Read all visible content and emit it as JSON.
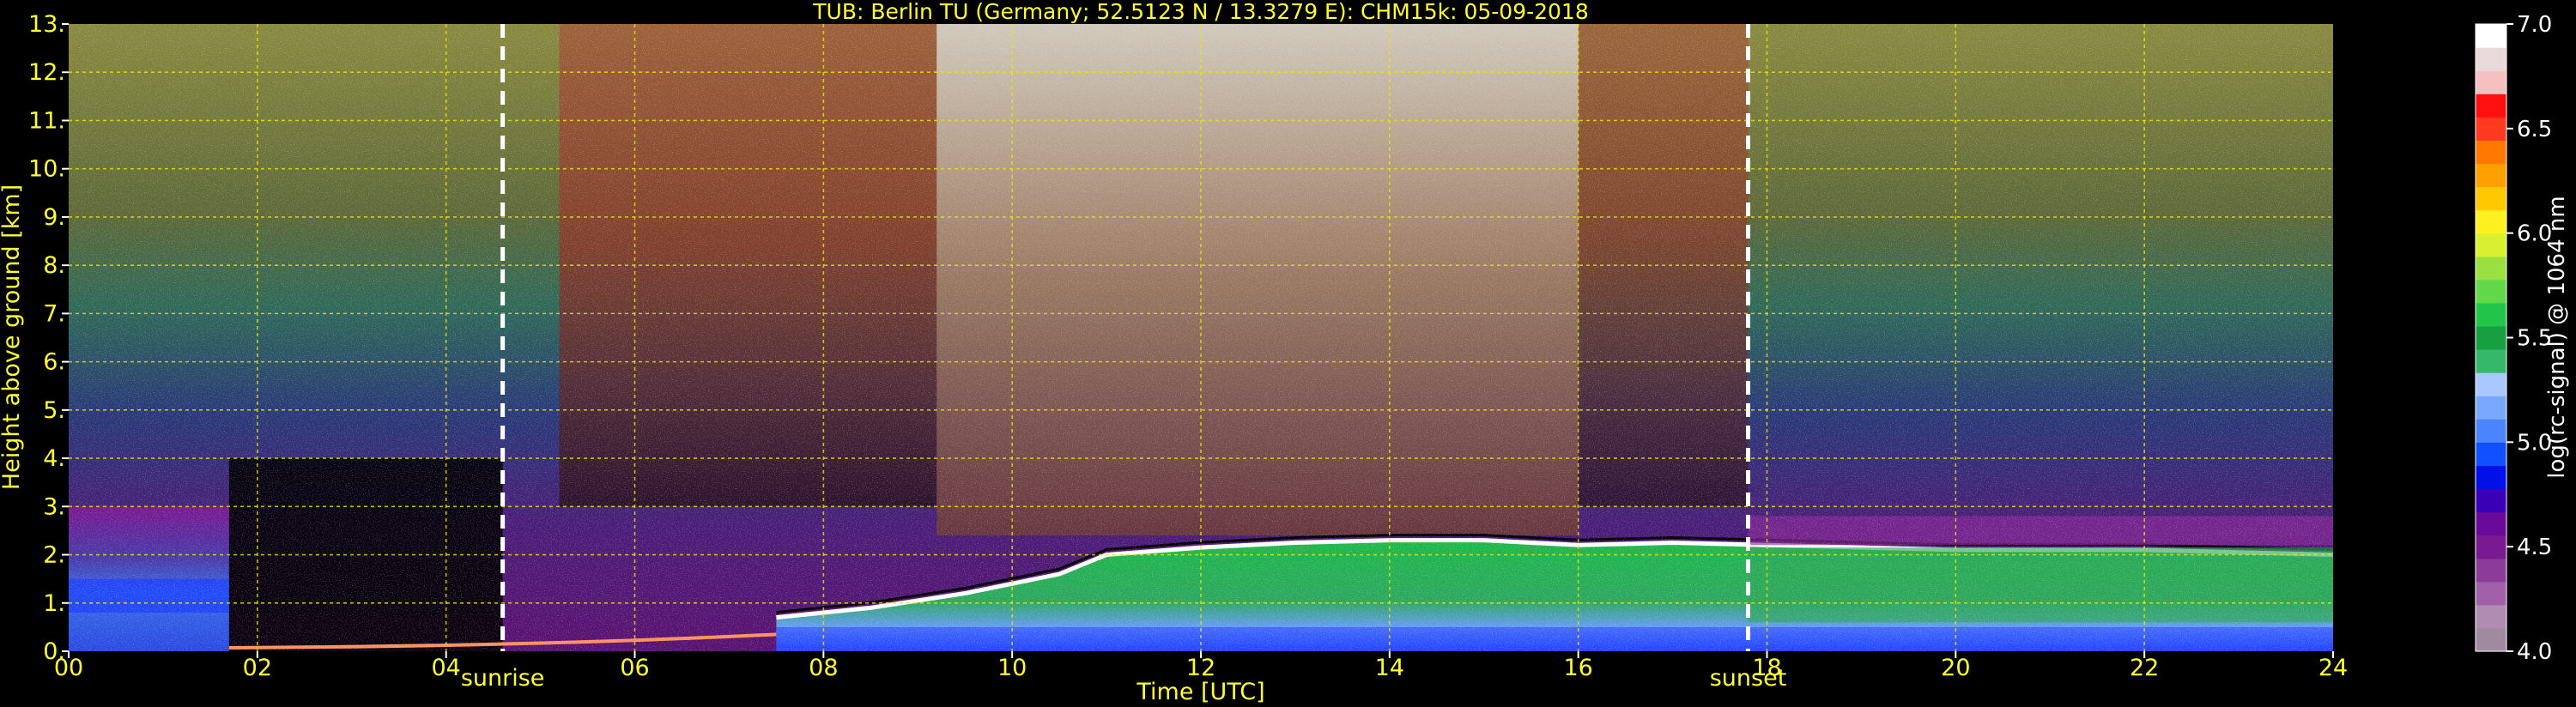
{
  "chart_data": {
    "type": "heatmap",
    "title": "TUB: Berlin TU (Germany; 52.5123 N / 13.3279 E):    CHM15k: 05-09-2018",
    "xlabel": "Time [UTC]",
    "ylabel": "Height above ground [km]",
    "xlim": [
      0,
      24
    ],
    "ylim": [
      0,
      13
    ],
    "x_ticks": [
      0,
      2,
      4,
      6,
      8,
      10,
      12,
      14,
      16,
      18,
      20,
      22,
      24
    ],
    "x_tick_labels": [
      "00",
      "02",
      "04",
      "06",
      "08",
      "10",
      "12",
      "14",
      "16",
      "18",
      "20",
      "22",
      "24"
    ],
    "y_ticks": [
      0,
      1,
      2,
      3,
      4,
      5,
      6,
      7,
      8,
      9,
      10,
      11,
      12,
      13
    ],
    "y_tick_labels": [
      "0.",
      "1.",
      "2.",
      "3.",
      "4.",
      "5.",
      "6.",
      "7.",
      "8.",
      "9.",
      "10.",
      "11.",
      "12.",
      "13."
    ],
    "grid": true,
    "colorbar": {
      "label": "log(rc-signal) @ 1064 nm",
      "range": [
        4.0,
        7.0
      ],
      "ticks": [
        4.0,
        4.5,
        5.0,
        5.5,
        6.0,
        6.5,
        7.0
      ],
      "tick_labels": [
        "4.0",
        "4.5",
        "5.0",
        "5.5",
        "6.0",
        "6.5",
        "7.0"
      ],
      "colors": [
        "#a08aa0",
        "#b08cb0",
        "#a060a8",
        "#8a3c98",
        "#7a1a90",
        "#6a0a9a",
        "#3a00b8",
        "#0010e8",
        "#1050ff",
        "#4a84ff",
        "#7aa8ff",
        "#a8c8ff",
        "#36b86a",
        "#16a040",
        "#22c44a",
        "#60d84a",
        "#9ae040",
        "#d8f030",
        "#fff020",
        "#ffc800",
        "#ffa000",
        "#ff7800",
        "#ff3a20",
        "#ff1010",
        "#f4c0c0",
        "#e8dada",
        "#ffffff"
      ]
    },
    "annotations": [
      {
        "label": "sunrise",
        "x": 4.6
      },
      {
        "label": "sunset",
        "x": 17.8
      }
    ],
    "layers": [
      {
        "name": "residual-layer",
        "x0": 0,
        "x1": 1.7,
        "top_km": 3.0
      },
      {
        "name": "boundary-layer-top",
        "x": [
          7.5,
          8.5,
          9.5,
          10.5,
          11.0,
          12.0,
          13.0,
          14.0,
          15.0,
          16.0,
          17.0,
          18.0,
          20.0,
          22.0,
          24.0
        ],
        "top_km": [
          0.7,
          0.9,
          1.2,
          1.6,
          2.0,
          2.15,
          2.25,
          2.3,
          2.3,
          2.2,
          2.25,
          2.2,
          2.1,
          2.1,
          2.0
        ]
      }
    ]
  }
}
